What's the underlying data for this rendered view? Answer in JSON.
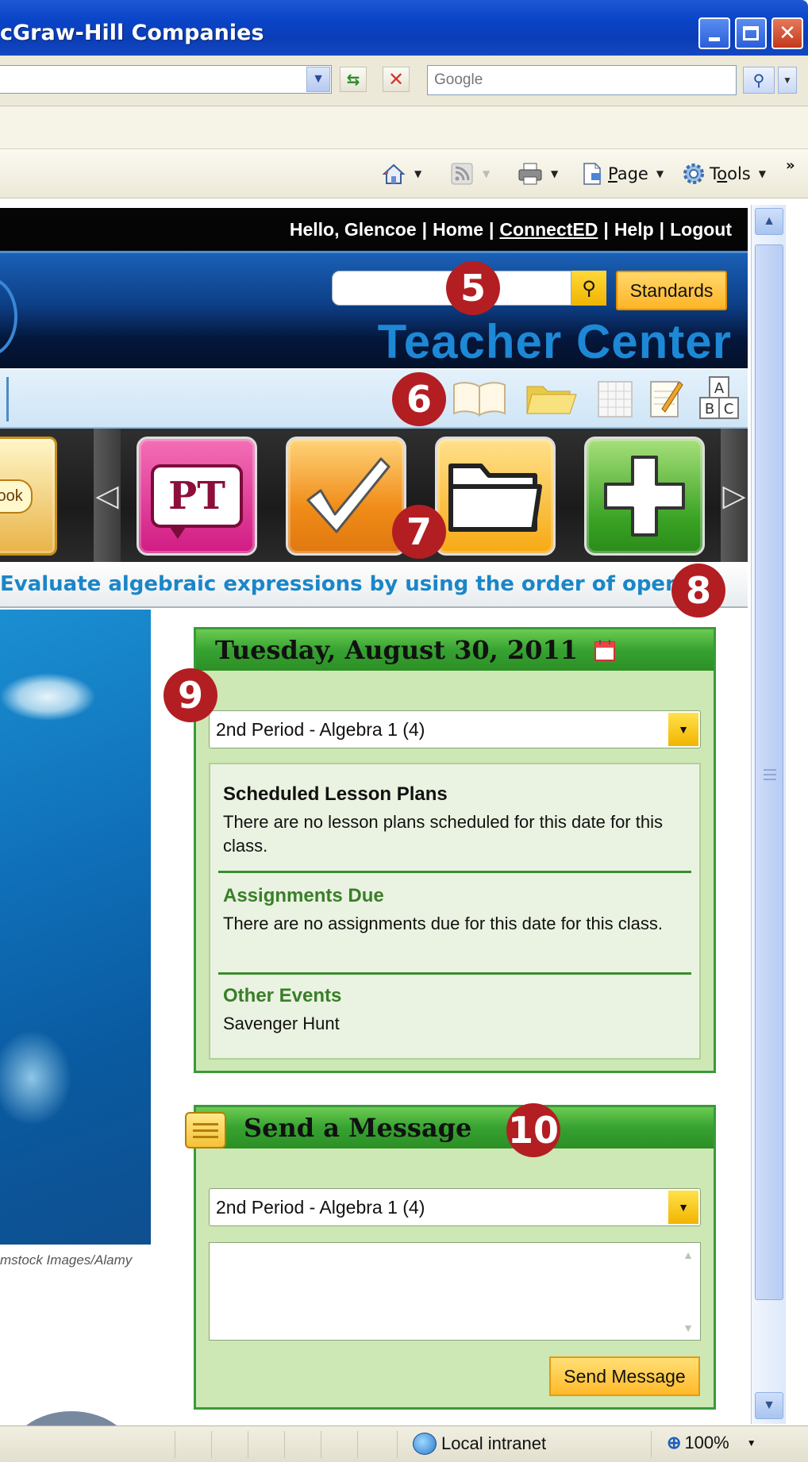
{
  "window": {
    "title": "cGraw-Hill Companies"
  },
  "address_bar": {
    "search_placeholder": "Google"
  },
  "command_bar": {
    "page_label": "Page",
    "tools_label": "Tools",
    "page_underline_char": "P",
    "tools_prefix": "T",
    "tools_underline_char": "o",
    "tools_suffix": "ols"
  },
  "top_nav": {
    "greeting": "Hello, Glencoe",
    "home": "Home",
    "connected": "ConnectED",
    "help": "Help",
    "logout": "Logout",
    "separator": "|"
  },
  "banner": {
    "standards_button": "Standards",
    "title": "Teacher Center"
  },
  "carousel": {
    "book_label": "Book",
    "pt_label": "PT"
  },
  "objective_text": "Evaluate algebraic expressions by using the order of operati",
  "photo_credit": "mstock Images/Alamy",
  "calendar_panel": {
    "date": "Tuesday, August 30, 2011",
    "class_select": "2nd Period - Algebra 1 (4)",
    "lesson_plans_heading": "Scheduled Lesson Plans",
    "lesson_plans_text": "There are no lesson plans scheduled for this date for this class.",
    "assignments_heading": "Assignments Due",
    "assignments_text": "There are no assignments due for this date for this class.",
    "events_heading": "Other Events",
    "events_text": "Savenger Hunt"
  },
  "message_panel": {
    "title": "Send a Message",
    "class_select": "2nd Period - Algebra 1 (4)",
    "send_button": "Send Message"
  },
  "callouts": [
    "5",
    "6",
    "7",
    "8",
    "9",
    "10"
  ],
  "status_bar": {
    "zone": "Local intranet",
    "zoom": "100%"
  },
  "colors": {
    "titlebar_blue": "#0a44c8",
    "banner_title": "#1d88d6",
    "objective_text": "#1a86c8",
    "panel_green": "#36a231",
    "callout_red": "#b31e23",
    "button_orange": "#ffb92a"
  }
}
